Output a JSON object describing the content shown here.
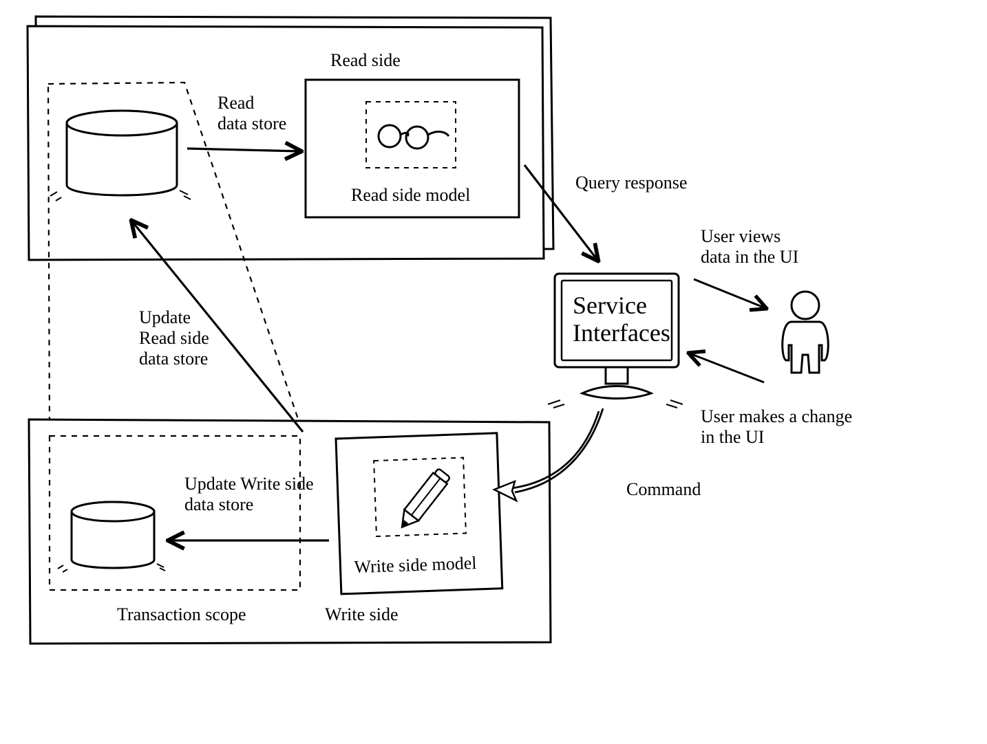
{
  "readSide": {
    "title": "Read side",
    "datastoreLabel": "Read\ndata store",
    "modelLabel": "Read side model"
  },
  "writeSide": {
    "title": "Write side",
    "modelLabel": "Write side model",
    "updateWriteLabel": "Update Write side\ndata store",
    "transactionScopeLabel": "Transaction scope"
  },
  "updateReadLabel": "Update\nRead side\ndata store",
  "service": {
    "label": "Service\nInterfaces"
  },
  "queryResponseLabel": "Query response",
  "commandLabel": "Command",
  "user": {
    "viewLabel": "User views\ndata in the UI",
    "changeLabel": "User makes a change\nin the UI"
  }
}
